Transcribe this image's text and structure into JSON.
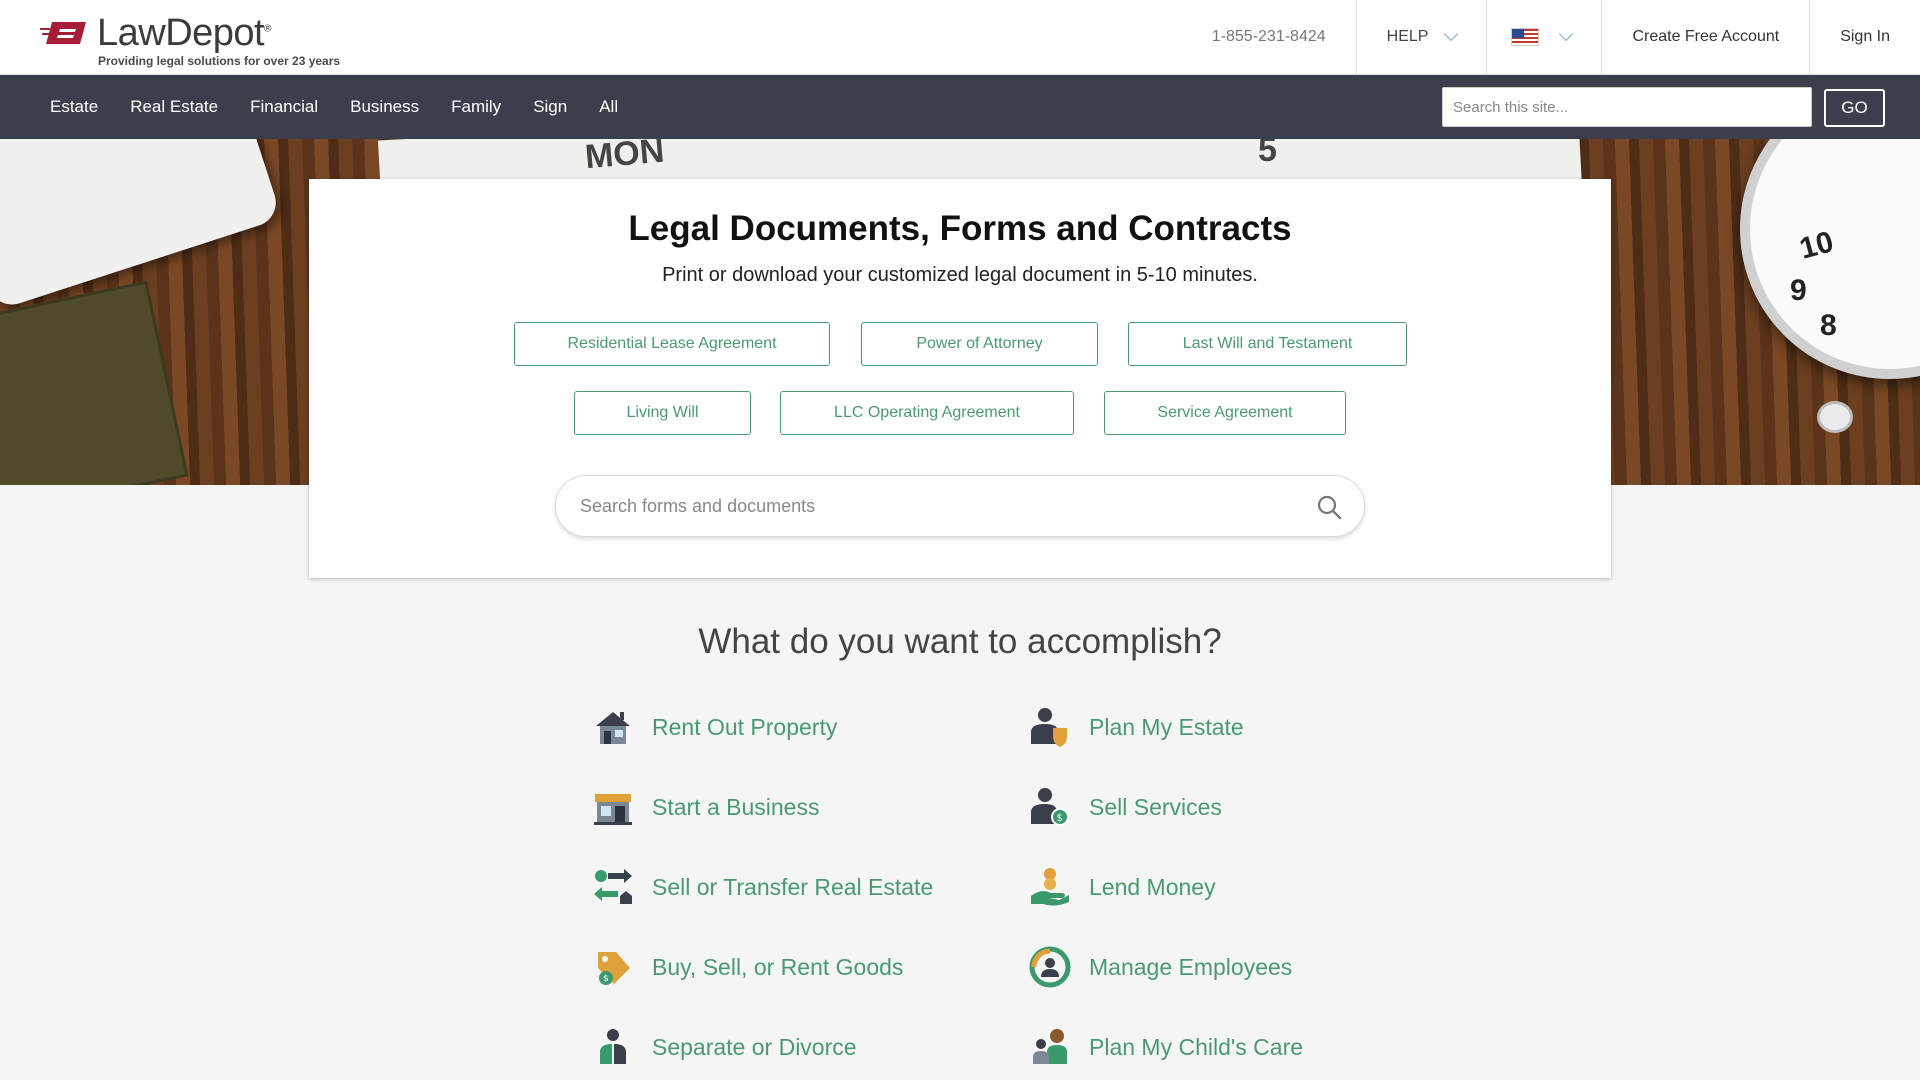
{
  "header": {
    "logo_text": "LawDepot",
    "logo_reg": "®",
    "tagline": "Providing legal solutions for over 23 years",
    "phone": "1-855-231-8424",
    "help": "HELP",
    "create_account": "Create Free Account",
    "sign_in": "Sign In",
    "brand_color": "#a41e35"
  },
  "nav": {
    "items": [
      "Estate",
      "Real Estate",
      "Financial",
      "Business",
      "Family",
      "Sign",
      "All"
    ],
    "search_placeholder": "Search this site...",
    "go_label": "GO"
  },
  "hero": {
    "calendar_day": "MON",
    "calendar_date": "5",
    "clock_numbers": [
      "10",
      "9",
      "8"
    ]
  },
  "card": {
    "title": "Legal Documents, Forms and Contracts",
    "subtitle": "Print or download your customized legal document in 5-10 minutes.",
    "quick_links": [
      "Residential Lease Agreement",
      "Power of Attorney",
      "Last Will and Testament",
      "Living Will",
      "LLC Operating Agreement",
      "Service Agreement"
    ],
    "search_placeholder": "Search forms and documents"
  },
  "accomplish": {
    "title": "What do you want to accomplish?",
    "left": [
      {
        "label": "Rent Out Property",
        "icon": "house-icon"
      },
      {
        "label": "Start a Business",
        "icon": "storefront-icon"
      },
      {
        "label": "Sell or Transfer Real Estate",
        "icon": "exchange-arrows-icon"
      },
      {
        "label": "Buy, Sell, or Rent Goods",
        "icon": "price-tag-icon"
      },
      {
        "label": "Separate or Divorce",
        "icon": "split-person-icon"
      }
    ],
    "right": [
      {
        "label": "Plan My Estate",
        "icon": "person-shield-icon"
      },
      {
        "label": "Sell Services",
        "icon": "person-dollar-icon"
      },
      {
        "label": "Lend Money",
        "icon": "hand-coin-icon"
      },
      {
        "label": "Manage Employees",
        "icon": "team-cycle-icon"
      },
      {
        "label": "Plan My Child's Care",
        "icon": "parent-child-icon"
      }
    ]
  },
  "colors": {
    "accent_green": "#4a9a70",
    "nav_bg": "#3a3f4b"
  }
}
